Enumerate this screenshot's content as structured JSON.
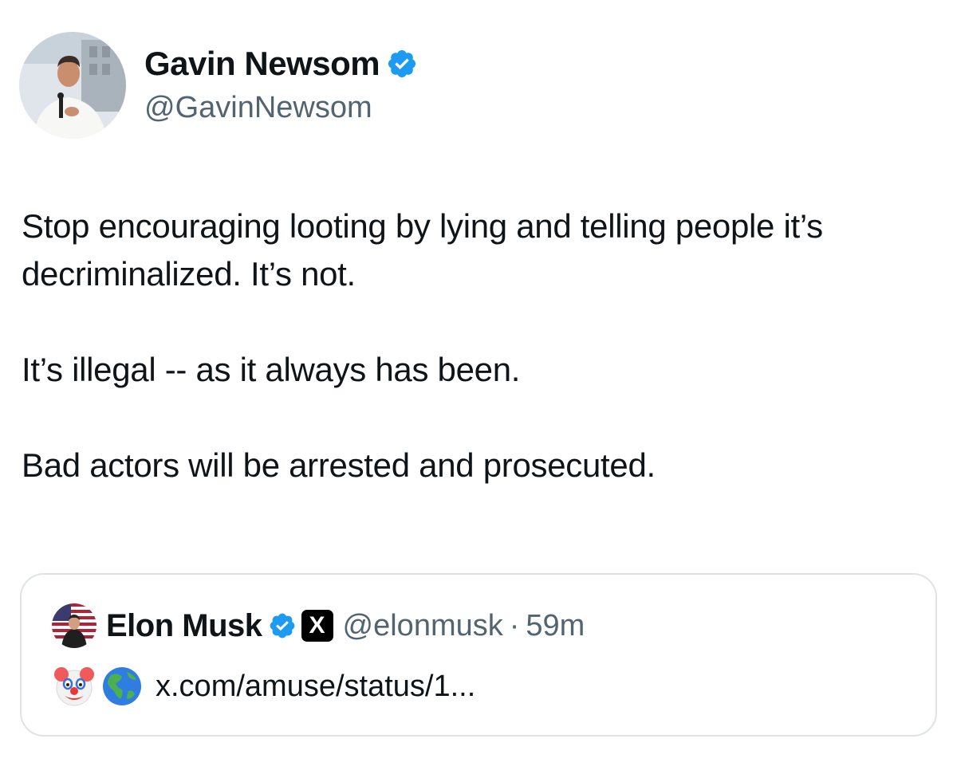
{
  "author": {
    "display_name": "Gavin Newsom",
    "handle": "@GavinNewsom",
    "avatar_icon": "avatar-photo-icon",
    "verified_icon": "verified-badge-icon"
  },
  "tweet": {
    "paragraphs": [
      "Stop encouraging looting by lying and telling people it’s decriminalized. It’s not.",
      "It’s illegal -- as it always has been.",
      "Bad actors will be arrested and prosecuted."
    ]
  },
  "quoted": {
    "display_name": "Elon Musk",
    "handle": "@elonmusk",
    "separator": "·",
    "time": "59m",
    "x_badge": "X",
    "emoji_icons": [
      "clown-face-icon",
      "globe-americas-icon"
    ],
    "link_text": "x.com/amuse/status/1..."
  },
  "colors": {
    "text": "#0f1419",
    "secondary": "#536471",
    "verified": "#1d9bf0",
    "border": "#dfe3e7"
  }
}
